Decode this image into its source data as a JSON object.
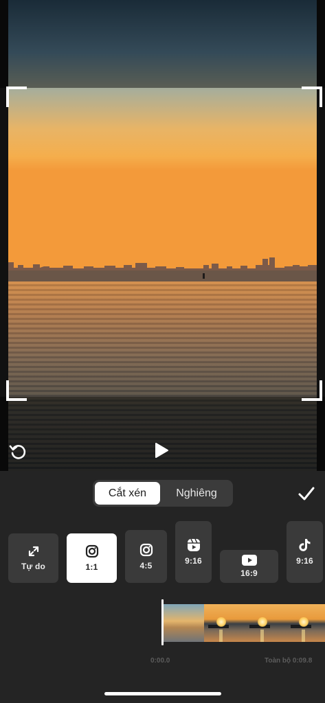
{
  "tabs": {
    "crop_label": "Cắt xén",
    "tilt_label": "Nghiêng"
  },
  "ratios": [
    {
      "label": "Tự do",
      "icon": "expand-icon",
      "selected": false
    },
    {
      "label": "1:1",
      "icon": "instagram-icon",
      "selected": true
    },
    {
      "label": "4:5",
      "icon": "instagram-icon",
      "selected": false
    },
    {
      "label": "9:16",
      "icon": "reels-icon",
      "selected": false
    },
    {
      "label": "16:9",
      "icon": "youtube-icon",
      "selected": false
    },
    {
      "label": "9:16",
      "icon": "tiktok-icon",
      "selected": false
    }
  ],
  "timeline": {
    "start_time": "0:00.0",
    "total_label": "Toàn bộ 0:09.8"
  },
  "colors": {
    "background": "#242424",
    "button": "#3a3a3a",
    "selected": "#ffffff",
    "accent_text": "#5c5c5c"
  }
}
